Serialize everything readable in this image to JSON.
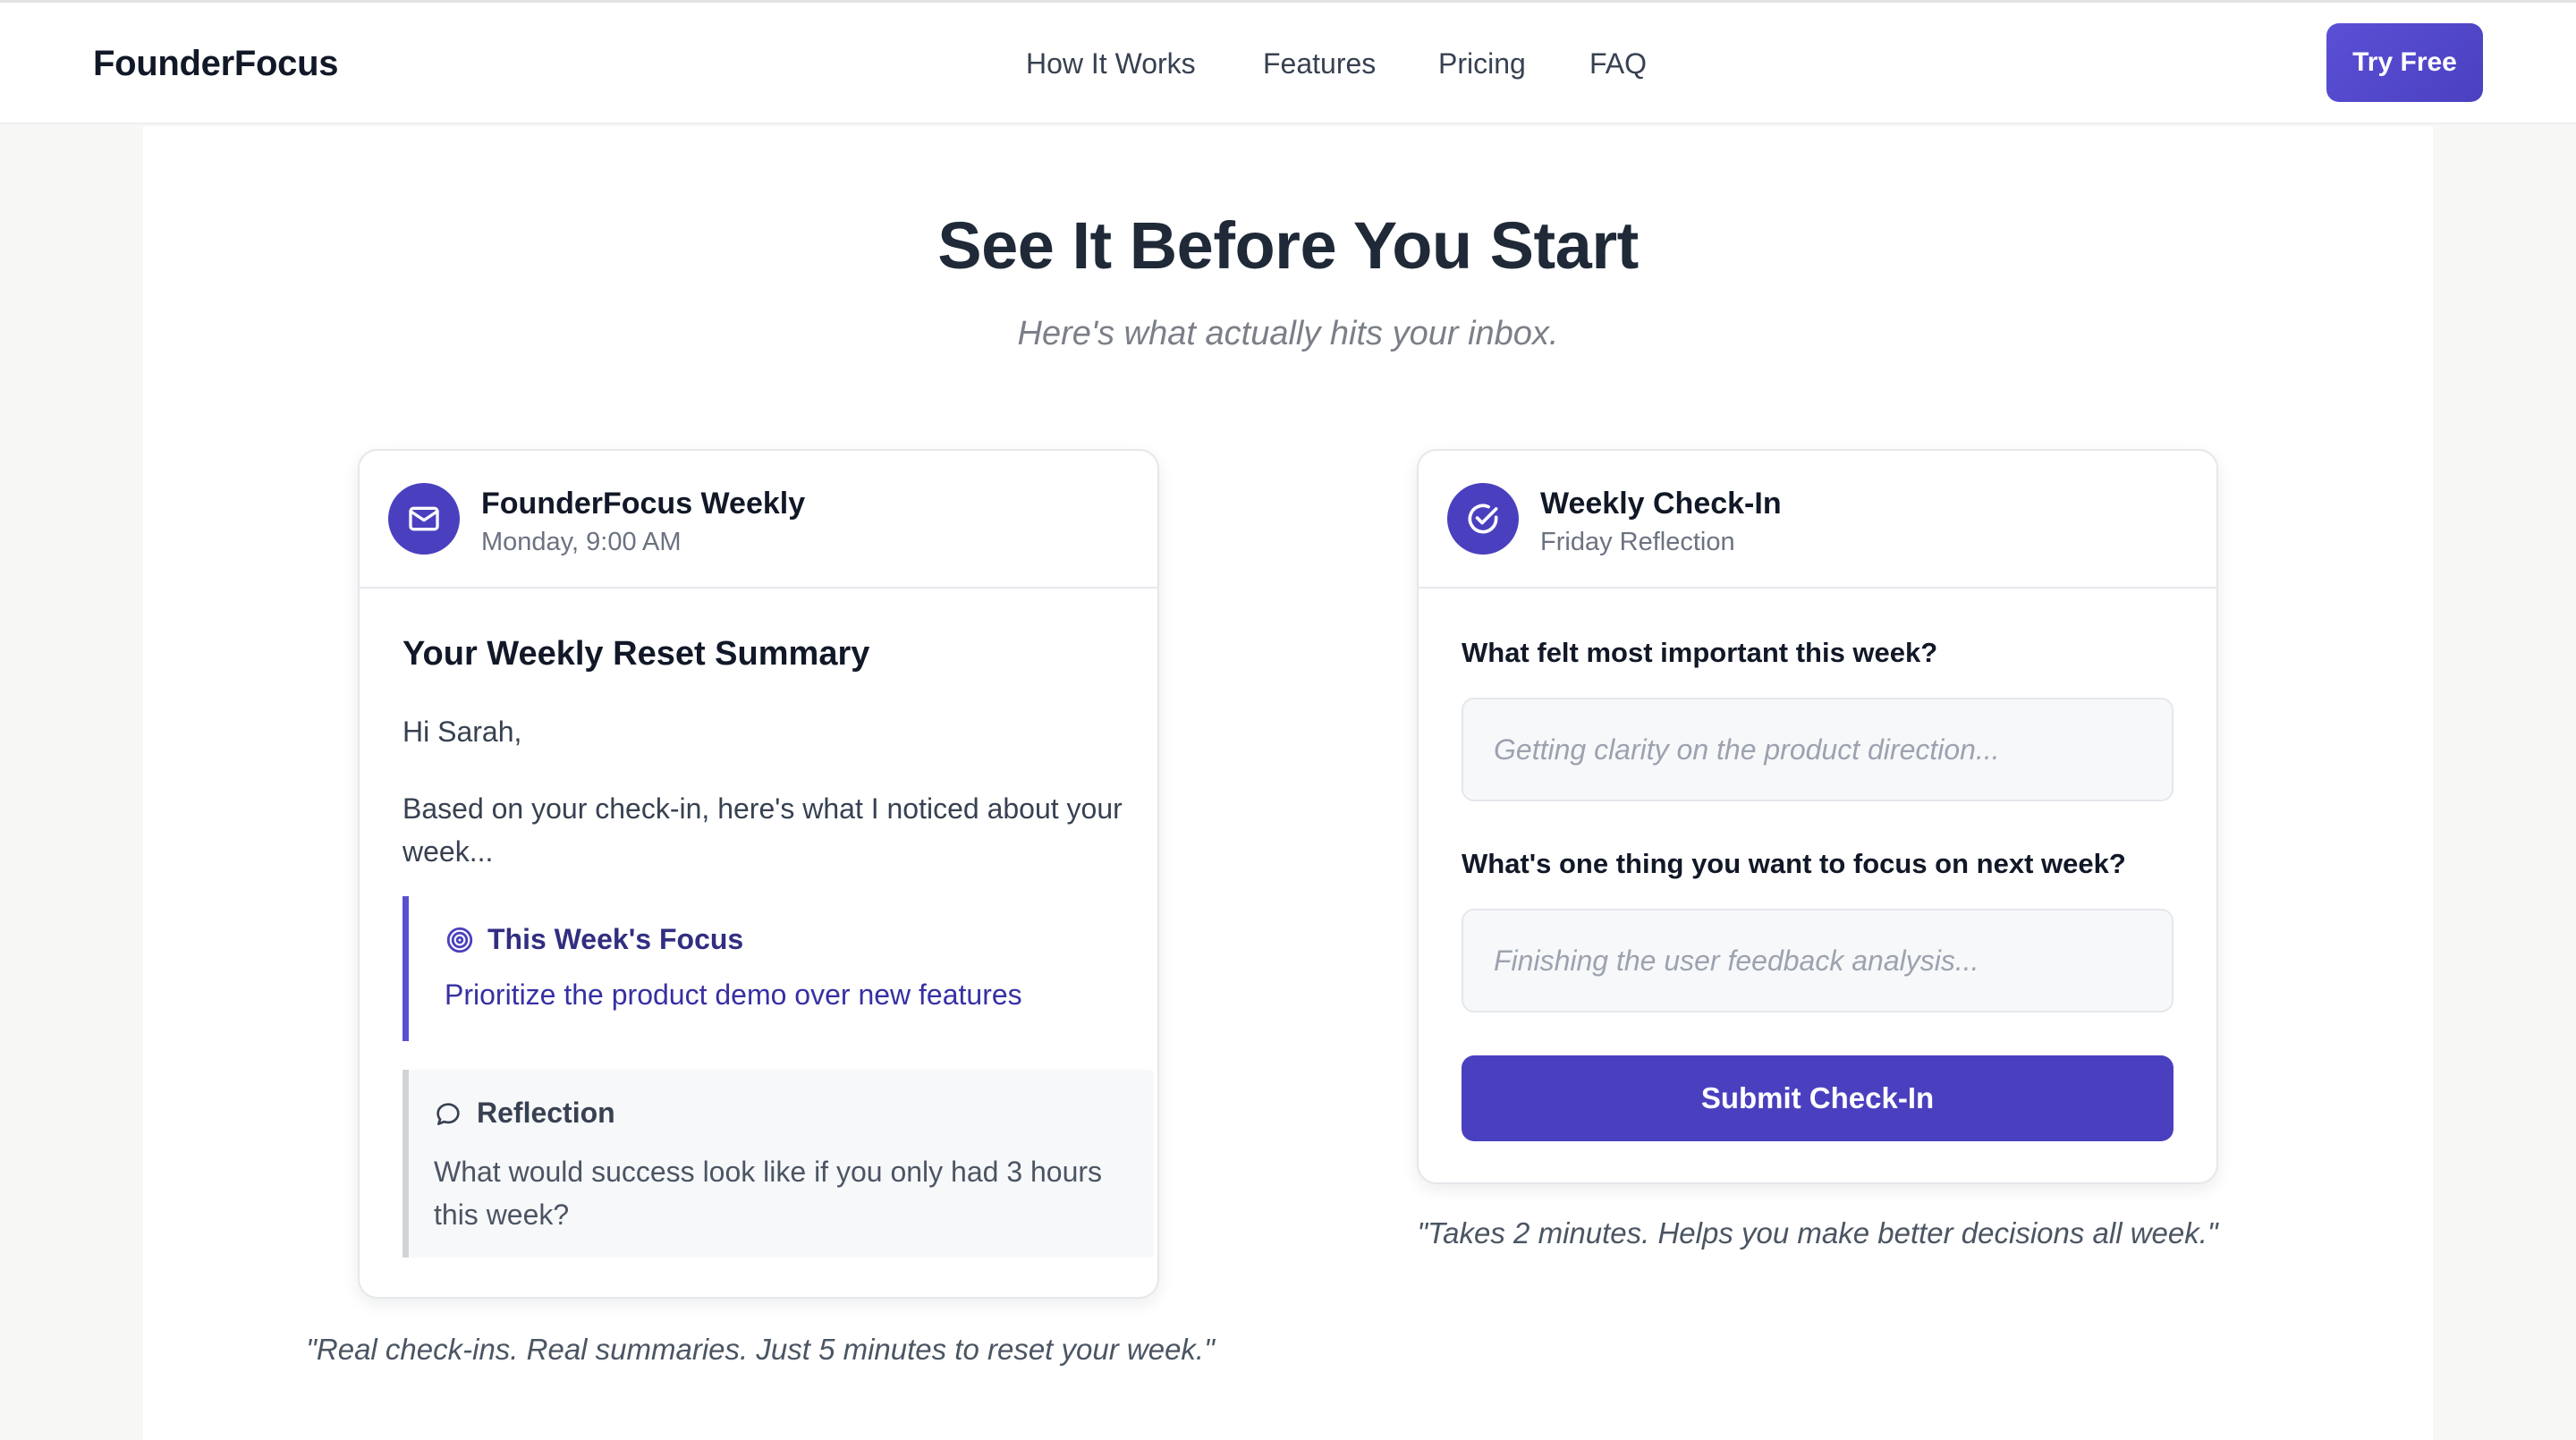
{
  "nav": {
    "logo": "FounderFocus",
    "links": [
      "How It Works",
      "Features",
      "Pricing",
      "FAQ"
    ],
    "cta": "Try Free"
  },
  "hero": {
    "title": "See It Before You Start",
    "subtitle": "Here's what actually hits your inbox."
  },
  "email_card": {
    "sender": "FounderFocus Weekly",
    "time": "Monday, 9:00 AM",
    "title": "Your Weekly Reset Summary",
    "greeting": "Hi Sarah,",
    "intro": "Based on your check-in, here's what I noticed about your week...",
    "focus_label": "This Week's Focus",
    "focus_text": "Prioritize the product demo over new features",
    "reflection_label": "Reflection",
    "reflection_text": "What would success look like if you only had 3 hours this week?",
    "caption": "\"Real check-ins. Real summaries. Just 5 minutes to reset your week.\""
  },
  "checkin_card": {
    "title": "Weekly Check-In",
    "subtitle": "Friday Reflection",
    "q1_label": "What felt most important this week?",
    "q1_placeholder": "Getting clarity on the product direction...",
    "q2_label": "What's one thing you want to focus on next week?",
    "q2_placeholder": "Finishing the user feedback analysis...",
    "submit": "Submit Check-In",
    "caption": "\"Takes 2 minutes. Helps you make better decisions all week.\""
  },
  "colors": {
    "accent": "#4a40bf",
    "focus_text": "#3730a3",
    "background": "#f7f7f6"
  },
  "icons": {
    "email_card": "mail-icon",
    "checkin_card": "check-circle-icon",
    "focus": "target-icon",
    "reflection": "speech-bubble-icon"
  }
}
